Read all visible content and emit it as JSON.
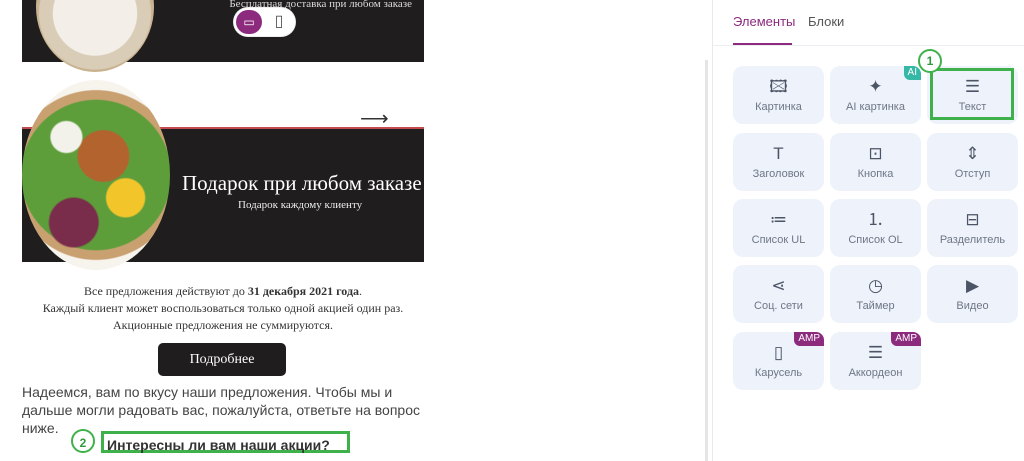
{
  "canvas": {
    "top_banner_subtitle": "Бесплатная доставка при любом заказе",
    "device_toggle": {
      "desktop_icon": "monitor-icon",
      "mobile_icon": "phone-icon"
    },
    "arrow": "⟶",
    "banner": {
      "title": "Подарок при любом заказе",
      "subtitle": "Подарок каждому клиенту"
    },
    "info": {
      "line1_prefix": "Все предложения действуют до ",
      "line1_date": "31 декабря 2021 года",
      "line1_suffix": ".",
      "line2": "Каждый клиент может воспользоваться только одной акцией один раз.",
      "line3": "Акционные предложения не суммируются."
    },
    "button_label": "Подробнее",
    "paragraph": "Надеемся, вам по вкусу наши предложения. Чтобы мы и дальше могли радовать вас, пожалуйста, ответьте на вопрос ниже.",
    "question": "Интересны ли вам наши акции?",
    "marker_2": "2"
  },
  "panel": {
    "tabs": [
      {
        "label": "Элементы",
        "active": true
      },
      {
        "label": "Блоки",
        "active": false
      }
    ],
    "marker_1": "1",
    "tiles": [
      {
        "label": "Картинка",
        "icon": "image-icon",
        "glyph": "🖾"
      },
      {
        "label": "AI картинка",
        "icon": "ai-image-icon",
        "glyph": "✦",
        "badge": "AI"
      },
      {
        "label": "Текст",
        "icon": "text-icon",
        "glyph": "☰"
      },
      {
        "label": "Заголовок",
        "icon": "heading-icon",
        "glyph": "T"
      },
      {
        "label": "Кнопка",
        "icon": "button-icon",
        "glyph": "⊡"
      },
      {
        "label": "Отступ",
        "icon": "spacer-icon",
        "glyph": "⇕"
      },
      {
        "label": "Список UL",
        "icon": "list-ul-icon",
        "glyph": "≔"
      },
      {
        "label": "Список OL",
        "icon": "list-ol-icon",
        "glyph": "⒈"
      },
      {
        "label": "Разделитель",
        "icon": "divider-icon",
        "glyph": "⊟"
      },
      {
        "label": "Соц. сети",
        "icon": "share-icon",
        "glyph": "⋖"
      },
      {
        "label": "Таймер",
        "icon": "clock-icon",
        "glyph": "◷"
      },
      {
        "label": "Видео",
        "icon": "video-icon",
        "glyph": "▶"
      },
      {
        "label": "Карусель",
        "icon": "carousel-icon",
        "glyph": "▯",
        "badge": "AMP"
      },
      {
        "label": "Аккордеон",
        "icon": "accordion-icon",
        "glyph": "☰",
        "badge": "AMP"
      }
    ]
  },
  "colors": {
    "accent": "#8c2a7e",
    "highlight": "#3fb14a",
    "tile_bg": "#eef2fb",
    "banner_bg": "#1f1d1e"
  }
}
